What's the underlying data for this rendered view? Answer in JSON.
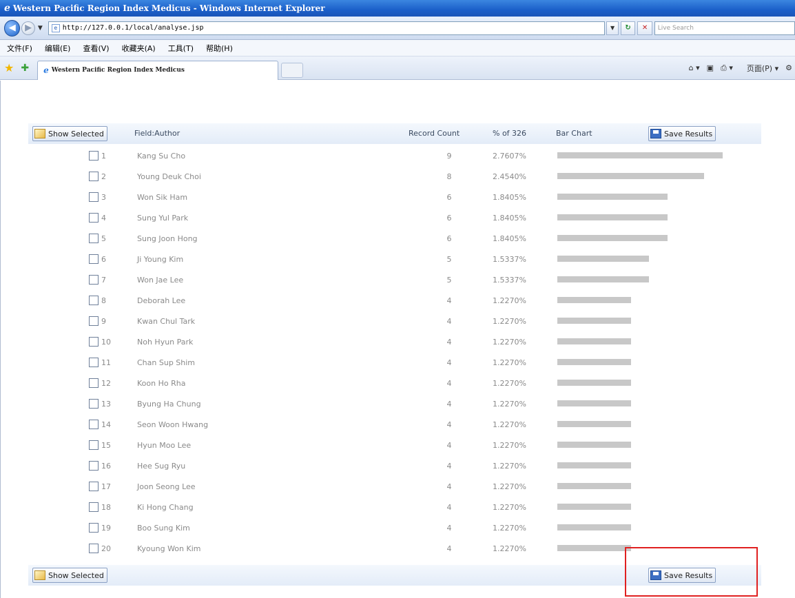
{
  "window": {
    "title": "Western Pacific Region Index Medicus - Windows Internet Explorer"
  },
  "address_bar": {
    "url": "http://127.0.0.1/local/analyse.jsp",
    "search_placeholder": "Live Search"
  },
  "menu": [
    "文件(F)",
    "编辑(E)",
    "查看(V)",
    "收藏夹(A)",
    "工具(T)",
    "帮助(H)"
  ],
  "tab": {
    "title": "Western Pacific Region Index Medicus"
  },
  "command_bar": {
    "page_label": "页面(P)"
  },
  "analysis": {
    "show_selected_label": "Show Selected",
    "save_results_label": "Save Results",
    "field_header": "Field:Author",
    "record_count_header": "Record Count",
    "percent_header": "% of 326",
    "bar_chart_header": "Bar Chart",
    "rows": [
      {
        "index": "1",
        "author": "Kang Su Cho",
        "count": "9",
        "percent": "2.7607%",
        "fraction": 0.0276
      },
      {
        "index": "2",
        "author": "Young Deuk Choi",
        "count": "8",
        "percent": "2.4540%",
        "fraction": 0.0245
      },
      {
        "index": "3",
        "author": "Won Sik Ham",
        "count": "6",
        "percent": "1.8405%",
        "fraction": 0.0184
      },
      {
        "index": "4",
        "author": "Sung Yul Park",
        "count": "6",
        "percent": "1.8405%",
        "fraction": 0.0184
      },
      {
        "index": "5",
        "author": "Sung Joon Hong",
        "count": "6",
        "percent": "1.8405%",
        "fraction": 0.0184
      },
      {
        "index": "6",
        "author": "Ji Young Kim",
        "count": "5",
        "percent": "1.5337%",
        "fraction": 0.0153
      },
      {
        "index": "7",
        "author": "Won Jae Lee",
        "count": "5",
        "percent": "1.5337%",
        "fraction": 0.0153
      },
      {
        "index": "8",
        "author": "Deborah Lee",
        "count": "4",
        "percent": "1.2270%",
        "fraction": 0.0123
      },
      {
        "index": "9",
        "author": "Kwan Chul Tark",
        "count": "4",
        "percent": "1.2270%",
        "fraction": 0.0123
      },
      {
        "index": "10",
        "author": "Noh Hyun Park",
        "count": "4",
        "percent": "1.2270%",
        "fraction": 0.0123
      },
      {
        "index": "11",
        "author": "Chan Sup Shim",
        "count": "4",
        "percent": "1.2270%",
        "fraction": 0.0123
      },
      {
        "index": "12",
        "author": "Koon Ho Rha",
        "count": "4",
        "percent": "1.2270%",
        "fraction": 0.0123
      },
      {
        "index": "13",
        "author": "Byung Ha Chung",
        "count": "4",
        "percent": "1.2270%",
        "fraction": 0.0123
      },
      {
        "index": "14",
        "author": "Seon Woon Hwang",
        "count": "4",
        "percent": "1.2270%",
        "fraction": 0.0123
      },
      {
        "index": "15",
        "author": "Hyun Moo Lee",
        "count": "4",
        "percent": "1.2270%",
        "fraction": 0.0123
      },
      {
        "index": "16",
        "author": "Hee Sug Ryu",
        "count": "4",
        "percent": "1.2270%",
        "fraction": 0.0123
      },
      {
        "index": "17",
        "author": "Joon Seong Lee",
        "count": "4",
        "percent": "1.2270%",
        "fraction": 0.0123
      },
      {
        "index": "18",
        "author": "Ki Hong Chang",
        "count": "4",
        "percent": "1.2270%",
        "fraction": 0.0123
      },
      {
        "index": "19",
        "author": "Boo Sung Kim",
        "count": "4",
        "percent": "1.2270%",
        "fraction": 0.0123
      },
      {
        "index": "20",
        "author": "Kyoung Won Kim",
        "count": "4",
        "percent": "1.2270%",
        "fraction": 0.0123
      }
    ]
  },
  "colors": {
    "highlight": "#e02020",
    "bar": "#c8c8c8"
  }
}
